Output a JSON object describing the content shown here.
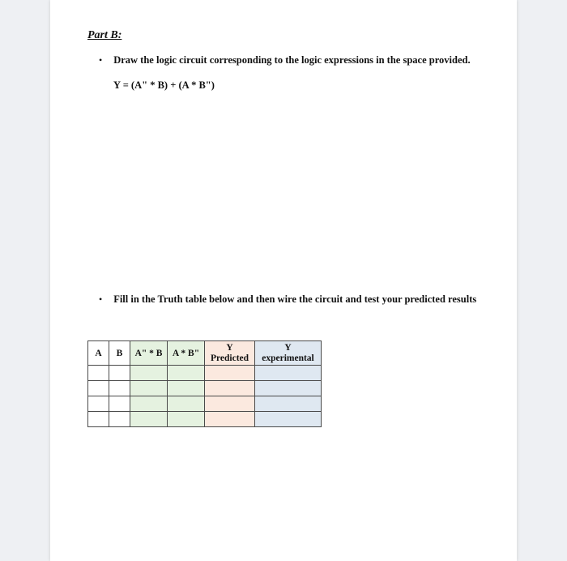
{
  "title": "Part B:",
  "bullets": {
    "b1": "Draw the logic circuit corresponding to the logic expressions in the space provided.",
    "b2": "Fill in the Truth table below  and then wire the circuit and test your predicted results"
  },
  "expression": "Y = (A\" * B) + (A * B\")",
  "table": {
    "headers": {
      "a": "A",
      "b": "B",
      "ab1": "A\" * B",
      "ab2": "A * B\"",
      "yp_top": "Y",
      "yp_bot": "Predicted",
      "ye_top": "Y",
      "ye_bot": "experimental"
    },
    "rows": [
      {
        "a": "",
        "b": "",
        "ab1": "",
        "ab2": "",
        "yp": "",
        "ye": ""
      },
      {
        "a": "",
        "b": "",
        "ab1": "",
        "ab2": "",
        "yp": "",
        "ye": ""
      },
      {
        "a": "",
        "b": "",
        "ab1": "",
        "ab2": "",
        "yp": "",
        "ye": ""
      },
      {
        "a": "",
        "b": "",
        "ab1": "",
        "ab2": "",
        "yp": "",
        "ye": ""
      }
    ]
  }
}
